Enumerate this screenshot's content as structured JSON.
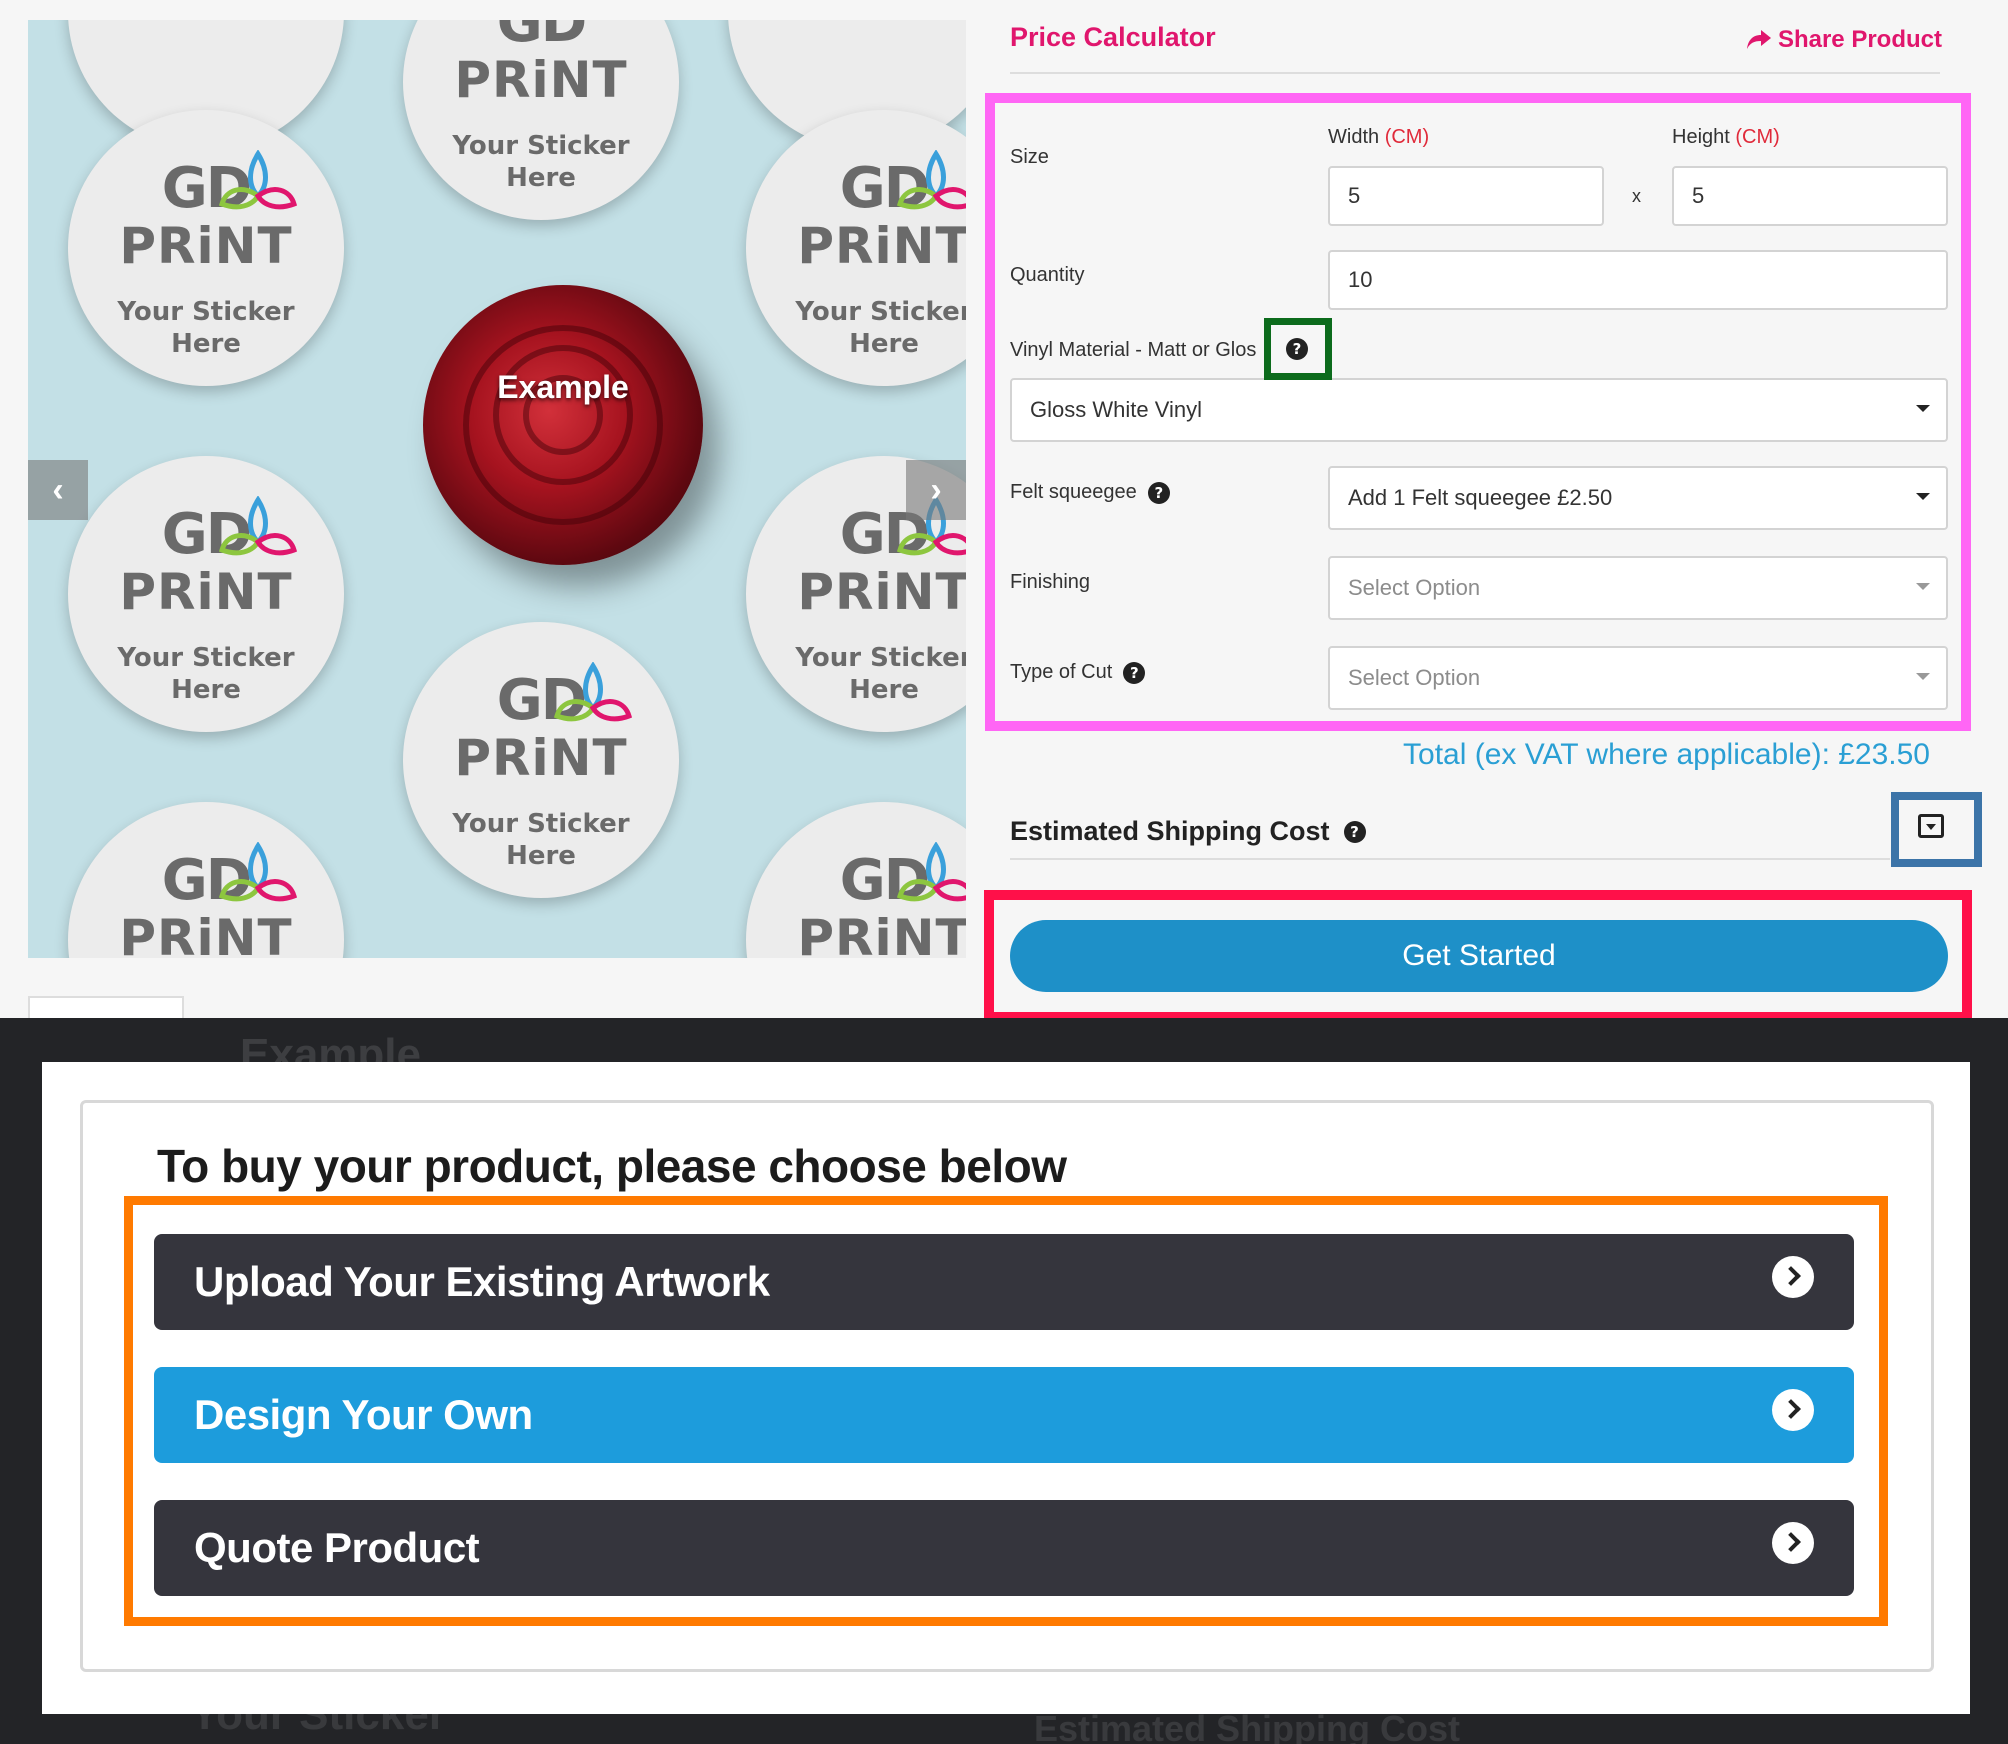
{
  "gallery": {
    "sticker_logo_line1": "GD",
    "sticker_logo_line2": "PRiNT",
    "sticker_caption_line1": "Your Sticker",
    "sticker_caption_line2": "Here",
    "example_label": "Example"
  },
  "calculator": {
    "title": "Price Calculator",
    "share_label": "Share Product",
    "size_label": "Size",
    "width_label": "Width",
    "height_label": "Height",
    "unit": "(CM)",
    "width_value": "5",
    "height_value": "5",
    "times": "x",
    "quantity_label": "Quantity",
    "quantity_value": "10",
    "vinyl_label": "Vinyl Material - Matt or Glos",
    "vinyl_value": "Gloss White Vinyl",
    "felt_label": "Felt squeegee",
    "felt_value": "Add 1 Felt squeegee £2.50",
    "finishing_label": "Finishing",
    "finishing_value": "Select Option",
    "cut_label": "Type of Cut",
    "cut_value": "Select Option",
    "help_glyph": "?"
  },
  "total_text": "Total (ex VAT where applicable): £23.50",
  "shipping": {
    "title": "Estimated Shipping Cost"
  },
  "get_started_label": "Get Started",
  "modal": {
    "title": "To buy your product, please choose below",
    "options": [
      {
        "label": "Upload Your Existing Artwork",
        "style": "dark"
      },
      {
        "label": "Design Your Own",
        "style": "blue"
      },
      {
        "label": "Quote Product",
        "style": "dark"
      }
    ]
  },
  "background_ghost": {
    "example": "Example",
    "sticker": "Your Sticker",
    "shipping": "Estimated Shipping Cost"
  },
  "colors": {
    "accent_pink": "#e0166d",
    "total_blue": "#2a9fd4",
    "button_blue": "#1e90c8",
    "choice_dark": "#35353d",
    "choice_blue": "#1d9cdc",
    "highlight_pink": "#ff66f5",
    "highlight_green": "#0c6b1c",
    "highlight_blue": "#3c74a8",
    "highlight_red": "#ff1049",
    "highlight_orange": "#ff7a00"
  },
  "icons": {
    "share": "share-arrow-icon",
    "help": "question-circle-icon",
    "caret": "caret-down-icon",
    "chevron": "chevron-right-circle-icon",
    "prev": "chevron-left-icon",
    "next": "chevron-right-icon"
  }
}
